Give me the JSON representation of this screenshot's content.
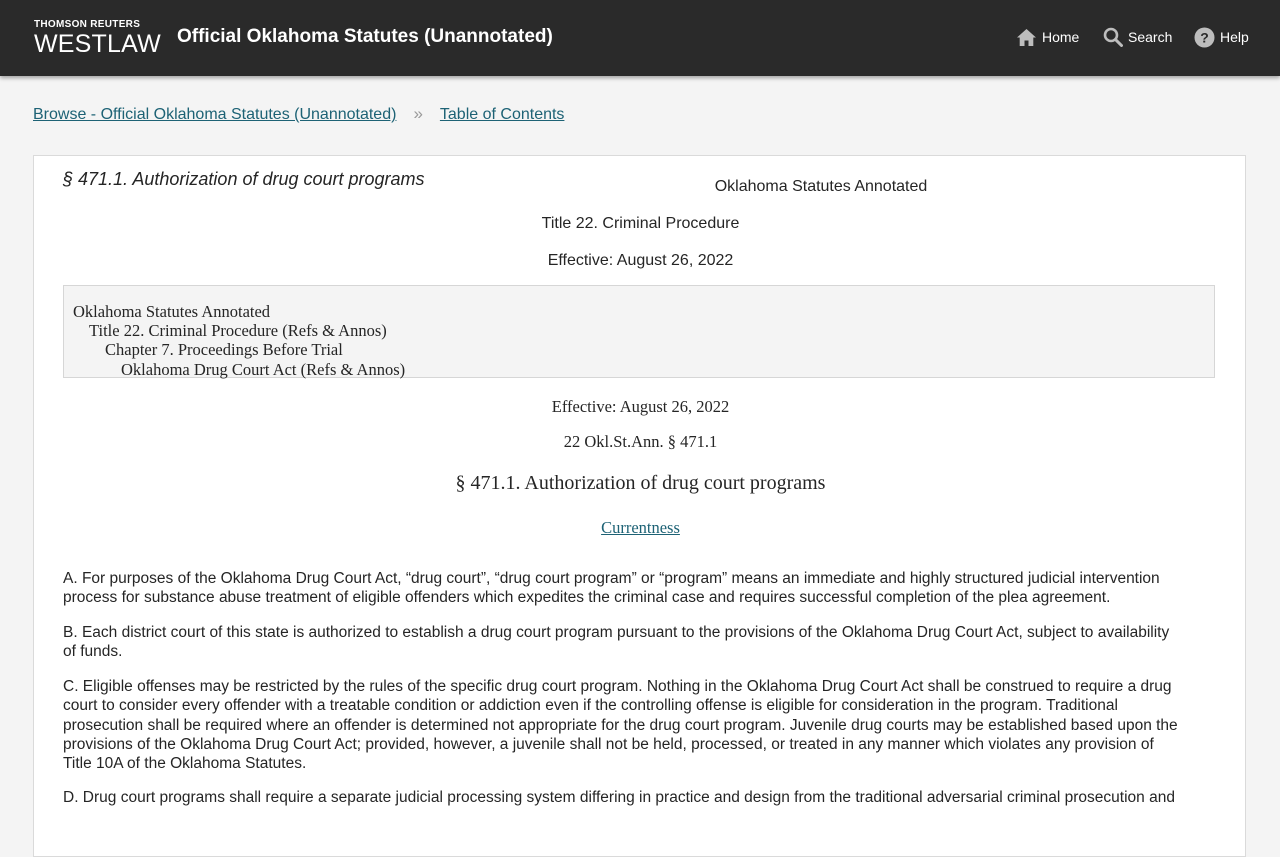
{
  "header": {
    "brand_top": "THOMSON REUTERS",
    "brand_name": "WESTLAW",
    "title": "Official Oklahoma Statutes (Unannotated)",
    "nav": [
      {
        "label": "Home",
        "icon": "home-icon"
      },
      {
        "label": "Search",
        "icon": "search-icon"
      },
      {
        "label": "Help",
        "icon": "help-icon"
      }
    ]
  },
  "breadcrumb": {
    "items": [
      "Browse - Official Oklahoma Statutes (Unannotated)",
      "Table of Contents"
    ],
    "separator": "»"
  },
  "document": {
    "heading": "§ 471.1. Authorization of drug court programs",
    "source": "Oklahoma Statutes Annotated",
    "title_line": "Title 22. Criminal Procedure",
    "effective_top": "Effective: August 26, 2022",
    "hierarchy": [
      "Oklahoma Statutes Annotated",
      "Title 22. Criminal Procedure (Refs & Annos)",
      "Chapter 7. Proceedings Before Trial",
      "Oklahoma Drug Court Act (Refs & Annos)"
    ],
    "effective": "Effective: August 26, 2022",
    "citation": "22 Okl.St.Ann. § 471.1",
    "section_title": "§ 471.1. Authorization of drug court programs",
    "currentness_link": "Currentness",
    "paragraphs": {
      "a": [
        "A. For purposes of the Oklahoma Drug Court Act, “drug court”, “drug court program” or “program” means an immediate and highly structured judicial intervention",
        "process for substance abuse treatment of eligible offenders which expedites the criminal case and requires successful completion of the plea agreement."
      ],
      "b": [
        "B. Each district court of this state is authorized to establish a drug court program pursuant to the provisions of the Oklahoma Drug Court Act, subject to availability",
        "of funds."
      ],
      "c": [
        "C. Eligible offenses may be restricted by the rules of the specific drug court program. Nothing in the Oklahoma Drug Court Act shall be construed to require a drug",
        "court to consider every offender with a treatable condition or addiction even if the controlling offense is eligible for consideration in the program. Traditional",
        "prosecution shall be required where an offender is determined not appropriate for the drug court program. Juvenile drug courts may be established based upon the",
        "provisions of the Oklahoma Drug Court Act; provided, however, a juvenile shall not be held, processed, or treated in any manner which violates any provision of",
        "Title 10A of the Oklahoma Statutes."
      ],
      "d": [
        "D. Drug court programs shall require a separate judicial processing system differing in practice and design from the traditional adversarial criminal prosecution and"
      ]
    }
  }
}
